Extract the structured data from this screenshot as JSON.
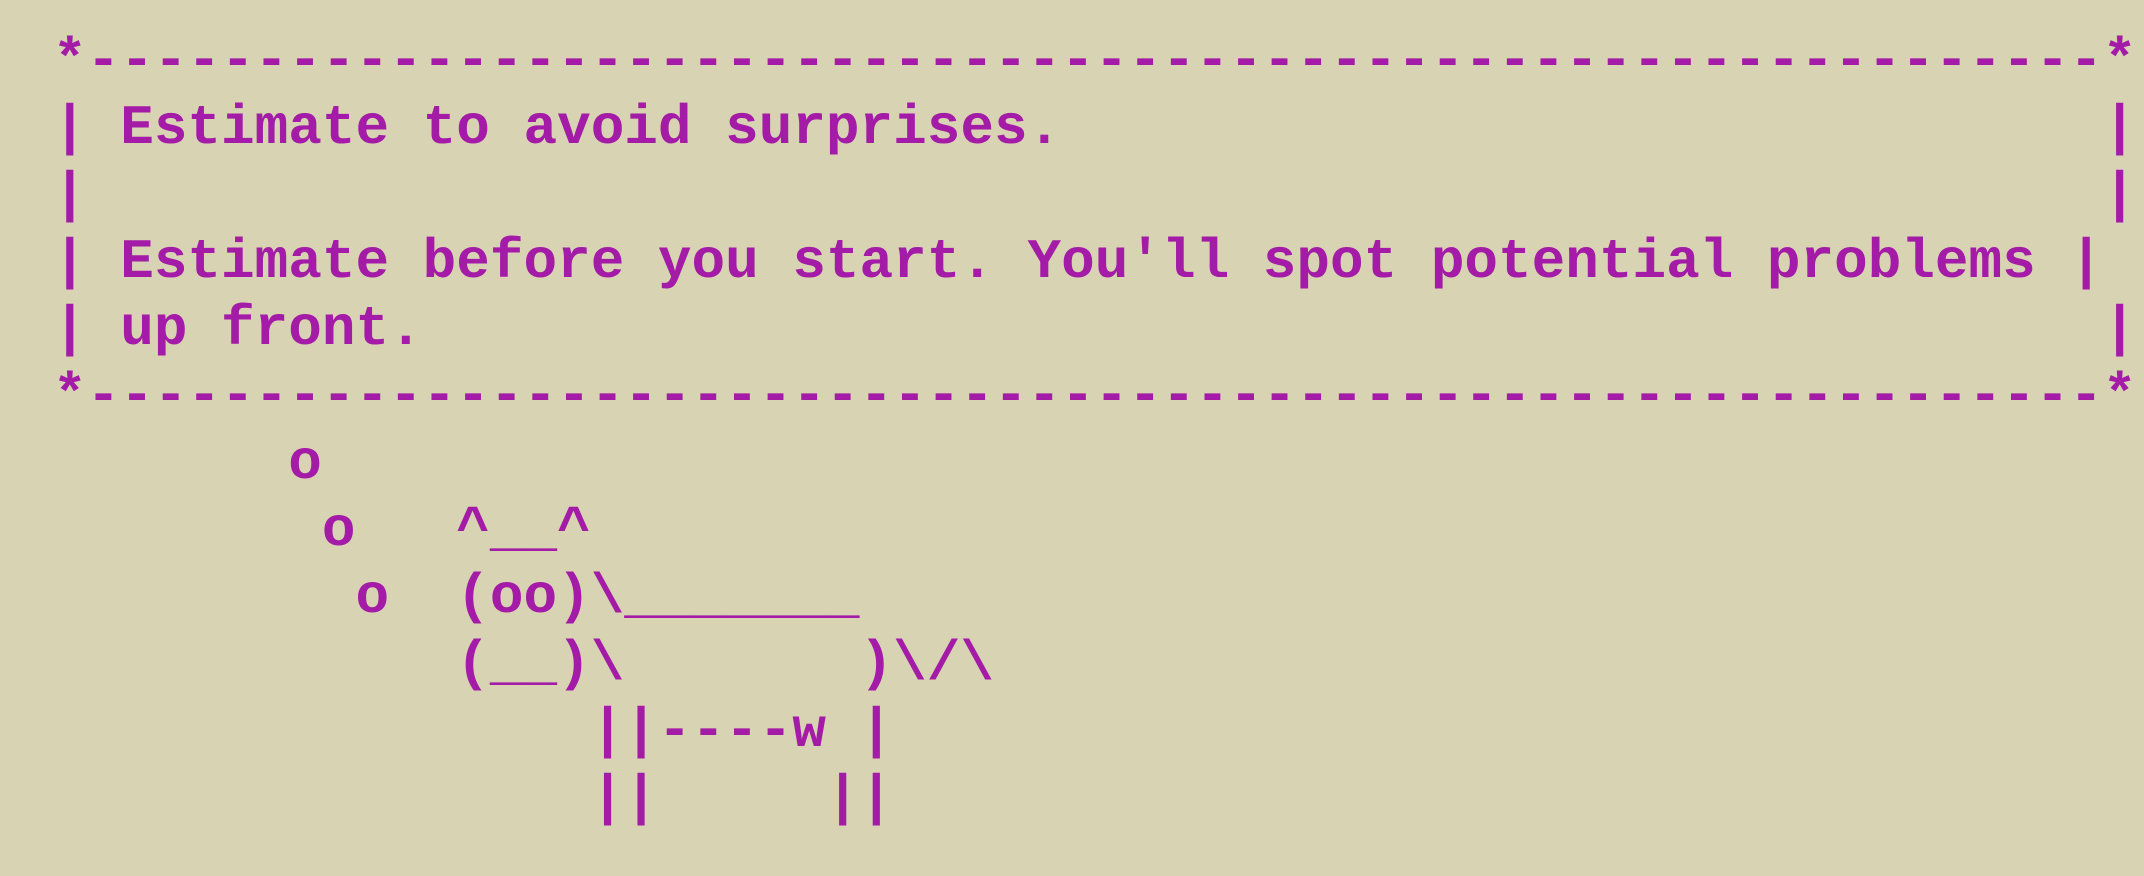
{
  "lines": [
    "*------------------------------------------------------------*",
    "| Estimate to avoid surprises.                               |",
    "|                                                            |",
    "| Estimate before you start. You'll spot potential problems |",
    "| up front.                                                  |",
    "*------------------------------------------------------------*",
    "       o",
    "        o   ^__^",
    "         o  (oo)\\_______",
    "            (__)\\       )\\/\\",
    "                ||----w |",
    "                ||     ||"
  ],
  "colors": {
    "background": "#d8d3b3",
    "text": "#a31ba6"
  }
}
